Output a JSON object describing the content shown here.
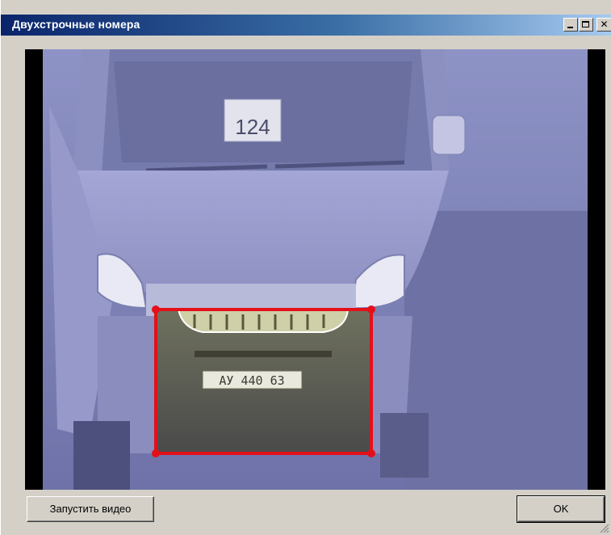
{
  "window": {
    "title": "Двухстрочные номера"
  },
  "video": {
    "sign_number": "124",
    "plate_text": "АУ 440 63",
    "roi_color": "#e3101a",
    "tint_color": "#7b7fb2"
  },
  "buttons": {
    "start_video_label": "Запустить видео",
    "ok_label": "OK"
  }
}
